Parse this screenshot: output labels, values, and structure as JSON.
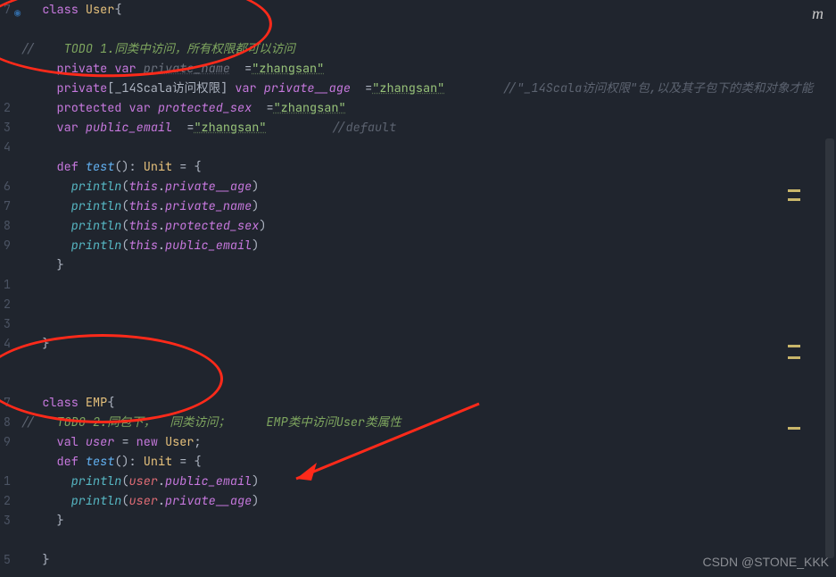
{
  "top_icon": "◉",
  "m_badge": "m",
  "watermark": "CSDN @STONE_KKK",
  "gutter": [
    "7",
    "",
    "",
    "",
    "",
    "2",
    "3",
    "4",
    "",
    "6",
    "7",
    "8",
    "9",
    "",
    "1",
    "2",
    "3",
    "4",
    "",
    "",
    "7",
    "8",
    "9",
    "",
    "1",
    "2",
    "3",
    "",
    "5"
  ],
  "code": {
    "l0": {
      "kw_class": "class",
      "cls": "User",
      "brace": "{"
    },
    "l2": {
      "slashes": "//",
      "todo": "TODO 1.",
      "zh": "同类中访问，所有权限都可以访问"
    },
    "l3": {
      "kw": "private",
      "var": "var",
      "name": "private_name",
      "eq": "=",
      "str": "\"zhangsan\""
    },
    "l4": {
      "kw": "private",
      "brkt": "[",
      "pkg": "_14Scala访问权限",
      "brkt2": "] ",
      "var": "var",
      "name": "private__age",
      "eq": "=",
      "str": "\"zhangsan\"",
      "cmt": "//\"_14Scala访问权限\"包,以及其子包下的类和对象才能"
    },
    "l5": {
      "kw": "protected",
      "var": "var",
      "name": "protected_sex",
      "eq": "=",
      "str": "\"zhangsan\""
    },
    "l6": {
      "var": "var",
      "name": "public_email",
      "eq": "=",
      "str": "\"zhangsan\"",
      "cmt": "//default"
    },
    "l8": {
      "kw": "def",
      "fn": "test",
      "paren": "():",
      "type": "Unit",
      "eq": "= {"
    },
    "l9": {
      "pr": "println",
      "p": "(",
      "this": "this",
      "dot": ".",
      "fld": "private__age",
      "cp": ")"
    },
    "l10": {
      "pr": "println",
      "p": "(",
      "this": "this",
      "dot": ".",
      "fld": "private_name",
      "cp": ")"
    },
    "l11": {
      "pr": "println",
      "p": "(",
      "this": "this",
      "dot": ".",
      "fld": "protected_sex",
      "cp": ")"
    },
    "l12": {
      "pr": "println",
      "p": "(",
      "this": "this",
      "dot": ".",
      "fld": "public_email",
      "cp": ")"
    },
    "l13": {
      "brace": "}"
    },
    "l17": {
      "brace": "}"
    },
    "l20": {
      "kw_class": "class",
      "cls": "EMP",
      "brace": "{"
    },
    "l21": {
      "slashes": "//",
      "todo": "TODO 2.",
      "zh1": "同包下，",
      "zh2": "同类访问；",
      "zh3": "EMP类中访问User类属性"
    },
    "l22": {
      "kw": "val",
      "name": "user",
      "eq": "=",
      "new": "new",
      "cls": "User",
      "semi": ";"
    },
    "l23": {
      "kw": "def",
      "fn": "test",
      "paren": "():",
      "type": "Unit",
      "eq": "= {"
    },
    "l24": {
      "pr": "println",
      "p": "(",
      "u": "user",
      "dot": ".",
      "fld": "public_email",
      "cp": ")"
    },
    "l25": {
      "pr": "println",
      "p": "(",
      "u": "user",
      "dot": ".",
      "fld": "private__age",
      "cp": ")"
    },
    "l26": {
      "brace": "}"
    },
    "l28": {
      "brace": "}"
    }
  }
}
